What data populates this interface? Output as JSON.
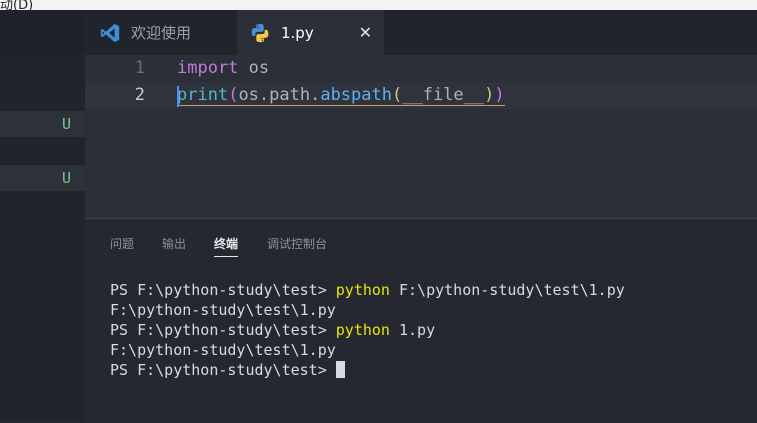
{
  "window": {
    "title_fragment": "动(D)"
  },
  "tabs": [
    {
      "label": "欢迎使用",
      "icon": "vscode-icon"
    },
    {
      "label": "1.py",
      "icon": "python-icon",
      "close": "✕"
    }
  ],
  "sidebar": {
    "badges": [
      "U",
      "U"
    ]
  },
  "editor": {
    "lines": [
      {
        "num": "1",
        "tokens": [
          "import",
          " os"
        ]
      },
      {
        "num": "2",
        "tokens": [
          "print",
          "(",
          "os.path.",
          "abspath",
          "(",
          "__file__",
          ")",
          ")"
        ]
      }
    ]
  },
  "panel": {
    "tabs": [
      "问题",
      "输出",
      "终端",
      "调试控制台"
    ],
    "active_tab": "终端"
  },
  "terminal": {
    "lines": [
      {
        "prompt": "PS F:\\python-study\\test> ",
        "cmd": "python",
        "rest": " F:\\python-study\\test\\1.py"
      },
      {
        "prompt": "F:\\python-study\\test\\1.py",
        "cmd": "",
        "rest": ""
      },
      {
        "prompt": "PS F:\\python-study\\test> ",
        "cmd": "python",
        "rest": " 1.py"
      },
      {
        "prompt": "F:\\python-study\\test\\1.py",
        "cmd": "",
        "rest": ""
      },
      {
        "prompt": "PS F:\\python-study\\test> ",
        "cmd": "",
        "rest": ""
      }
    ]
  },
  "colors": {
    "accent_keyword": "#c678dd",
    "function": "#61afef",
    "terminal_command": "#e5e510",
    "untracked_badge": "#73c991"
  }
}
